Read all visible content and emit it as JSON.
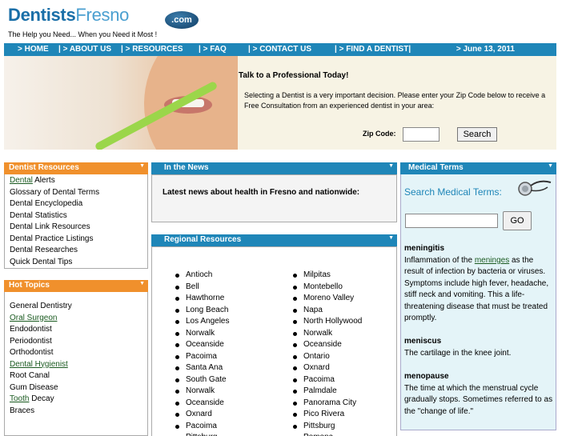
{
  "header": {
    "logo_part1": "Dentists",
    "logo_part2": "Fresno",
    "logo_badge": ".com",
    "tagline": "The Help you Need... When you Need it Most !"
  },
  "nav": {
    "items": [
      "> HOME",
      "| > ABOUT US",
      "| > RESOURCES",
      "| > FAQ",
      "| > CONTACT US",
      "| > FIND A DENTIST|"
    ],
    "date": "> June 13, 2011"
  },
  "hero": {
    "title": "Talk to a Professional Today!",
    "text": "Selecting a Dentist is a very important decision. Please enter your Zip Code below to receive a Free Consultation from an experienced dentist in your area:",
    "zip_label": "Zip Code:",
    "zip_value": "",
    "search_label": "Search"
  },
  "dentist_resources": {
    "title": "Dentist Resources",
    "first_link": "Dental",
    "first_rest": " Alerts",
    "items": [
      "Glossary of Dental Terms",
      "Dental Encyclopedia",
      "Dental Statistics",
      "Dental Link Resources",
      "Dental Practice Listings",
      "Dental Researches",
      "Quick Dental Tips"
    ]
  },
  "hot_topics": {
    "title": "Hot Topics",
    "items": [
      {
        "pre": "General Dentistry",
        "link": "",
        "post": ""
      },
      {
        "pre": "",
        "link": "Oral Surgeon",
        "post": ""
      },
      {
        "pre": "Endodontist",
        "link": "",
        "post": ""
      },
      {
        "pre": "Periodontist",
        "link": "",
        "post": ""
      },
      {
        "pre": "Orthodontist",
        "link": "",
        "post": ""
      },
      {
        "pre": "",
        "link": "Dental Hygienist",
        "post": ""
      },
      {
        "pre": "Root Canal",
        "link": "",
        "post": ""
      },
      {
        "pre": "Gum Disease",
        "link": "",
        "post": ""
      },
      {
        "pre": "",
        "link": "Tooth",
        "post": " Decay"
      },
      {
        "pre": "Braces",
        "link": "",
        "post": ""
      }
    ]
  },
  "news": {
    "title": "In the News",
    "text": "Latest news about health in Fresno and nationwide:"
  },
  "regional": {
    "title": "Regional Resources",
    "col1": [
      "Antioch",
      "Bell",
      "Hawthorne",
      "Long Beach",
      "Los Angeles",
      "Norwalk",
      "Oceanside",
      "Pacoima",
      "Santa Ana",
      "South Gate",
      "Norwalk",
      "Oceanside",
      "Oxnard",
      "Pacoima",
      "Pittsburg"
    ],
    "col2": [
      "Milpitas",
      "Montebello",
      "Moreno Valley",
      "Napa",
      "North Hollywood",
      "Norwalk",
      "Oceanside",
      "Ontario",
      "Oxnard",
      "Pacoima",
      "Palmdale",
      "Panorama City",
      "Pico Rivera",
      "Pittsburg",
      "Pomona"
    ]
  },
  "medical": {
    "title": "Medical Terms",
    "search_label": "Search Medical Terms:",
    "input_value": "",
    "go_label": "GO",
    "term1": "meningitis",
    "term1_pre": "Inflammation of the ",
    "term1_link": "meninges",
    "term1_post": " as the result of infection by bacteria or viruses. Symptoms include high fever, headache, stiff neck and vomiting. This a life-threatening disease that must be treated promptly.",
    "term2": "meniscus",
    "term2_def": "The cartilage in the knee joint.",
    "term3": "menopause",
    "term3_def": "The time at which the menstrual cycle gradually stops. Sometimes referred to as the \"change of life.\""
  },
  "colors": {
    "nav_blue": "#1f86b8",
    "orange": "#f0902c",
    "link_green": "#1a5a20"
  }
}
